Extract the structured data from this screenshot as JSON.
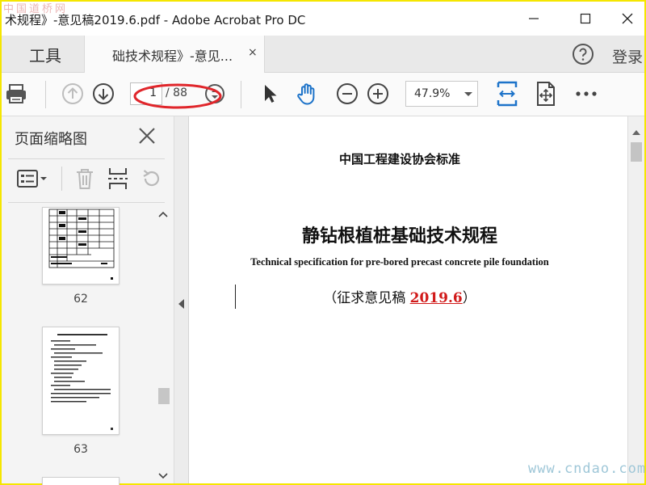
{
  "window": {
    "title": "术规程》-意见稿2019.6.pdf - Adobe Acrobat Pro DC",
    "watermark_top": "中国道桥网",
    "watermark_bottom": "www.cndao.com"
  },
  "tabs": {
    "tools_label": "工具",
    "document_label": "础技术规程》-意见...",
    "close_glyph": "×",
    "login_label": "登录"
  },
  "toolbar": {
    "page_current": "1",
    "page_total": "/ 88",
    "zoom": "47.9%",
    "highlight_color": "#e0262b"
  },
  "left_pane": {
    "title": "页面缩略图",
    "thumbnails": [
      {
        "label": "62"
      },
      {
        "label": "63"
      }
    ]
  },
  "document": {
    "organization": "中国工程建设协会标准",
    "title_cn": "静钻根植桩基础技术规程",
    "title_en": "Technical specification for pre-bored precast concrete pile foundation",
    "draft_prefix": "（征求意见稿 ",
    "draft_year": "2019.6",
    "draft_suffix": "）"
  },
  "colors": {
    "accent_blue": "#1d73c9",
    "frame_yellow": "#f5e600",
    "draft_red": "#d11a1a"
  }
}
